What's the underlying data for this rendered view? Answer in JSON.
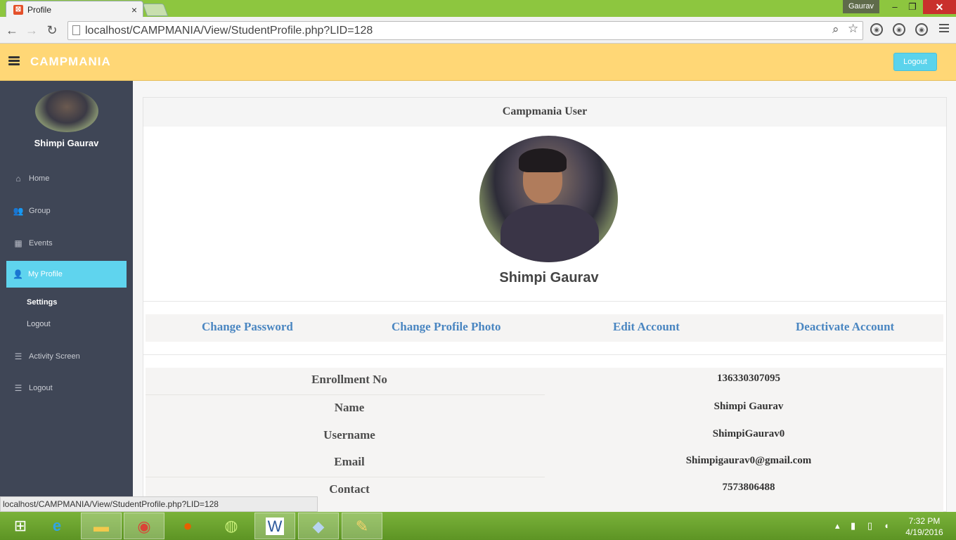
{
  "browser": {
    "tab_title": "Profile",
    "tab_close": "×",
    "user_badge": "Gaurav",
    "url": "localhost/CAMPMANIA/View/StudentProfile.php?LID=128",
    "status_url": "localhost/CAMPMANIA/View/StudentProfile.php?LID=128"
  },
  "header": {
    "brand": "CAMPMANIA",
    "logout_button": "Logout"
  },
  "sidebar": {
    "user_name": "Shimpi Gaurav",
    "items": [
      {
        "label": "Home",
        "icon": "home-icon"
      },
      {
        "label": "Group",
        "icon": "group-icon"
      },
      {
        "label": "Events",
        "icon": "calendar-icon"
      },
      {
        "label": "My Profile",
        "icon": "user-icon",
        "active": true
      },
      {
        "label": "Settings",
        "sub": true
      },
      {
        "label": "Logout",
        "sub": true
      },
      {
        "label": "Activity Screen",
        "icon": "list-icon"
      },
      {
        "label": "Logout",
        "icon": "list-icon"
      }
    ]
  },
  "profile": {
    "panel_title": "Campmania User",
    "name": "Shimpi Gaurav",
    "links": [
      "Change Password",
      "Change Profile Photo",
      "Edit Account",
      "Deactivate Account"
    ],
    "fields": [
      {
        "label": "Enrollment No",
        "value": "136330307095"
      },
      {
        "label": "Name",
        "value": "Shimpi Gaurav"
      },
      {
        "label": "Username",
        "value": "ShimpiGaurav0"
      },
      {
        "label": "Email",
        "value": "Shimpigaurav0@gmail.com"
      },
      {
        "label": "Contact",
        "value": "7573806488"
      }
    ]
  },
  "taskbar": {
    "time": "7:32 PM",
    "date": "4/19/2016"
  },
  "colors": {
    "header_bg": "#ffd776",
    "sidebar_bg": "#3f4656",
    "accent": "#5fd4ee",
    "link": "#4a86c1"
  }
}
